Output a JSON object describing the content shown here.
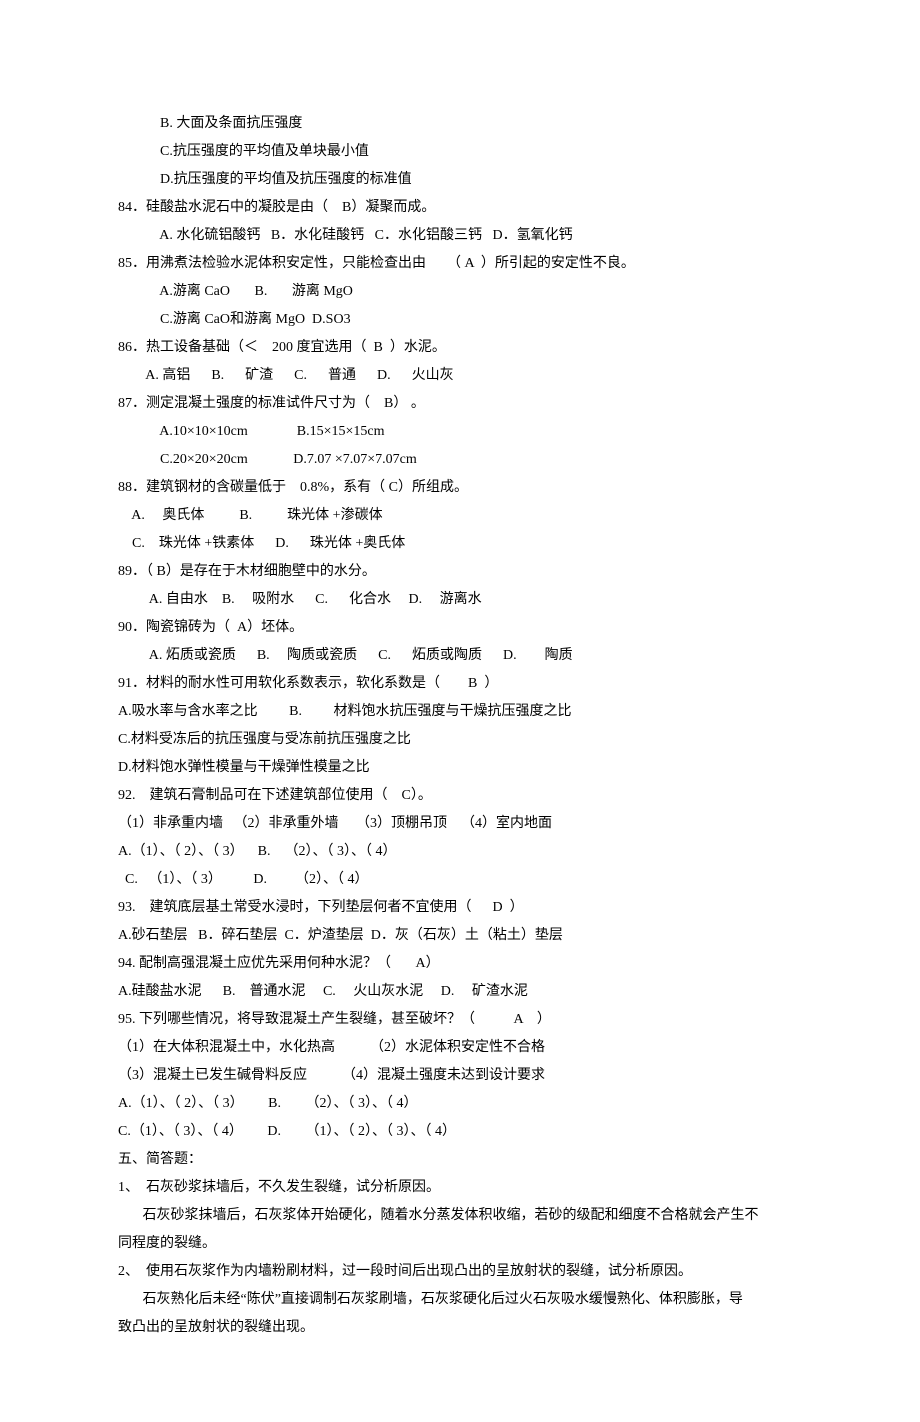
{
  "lines": [
    "            B. 大面及条面抗压强度",
    "            C.抗压强度的平均值及单块最小值",
    "            D.抗压强度的平均值及抗压强度的标准值",
    "84．硅酸盐水泥石中的凝胶是由（    B）凝聚而成。",
    "            A. 水化硫铝酸钙   B．水化硅酸钙   C．水化铝酸三钙   D．氢氧化钙",
    "85．用沸煮法检验水泥体积安定性，只能检查出由      （ A  ）所引起的安定性不良。",
    "            A.游离 CaO       B.       游离 MgO",
    "            C.游离 CaO和游离 MgO  D.SO3",
    "86．热工设备基础（＜    200 度宜选用（  B  ）水泥。",
    "        A. 高铝      B.      矿渣      C.      普通      D.      火山灰",
    "87．测定混凝土强度的标准试件尺寸为（    B） 。",
    "            A.10×10×10cm              B.15×15×15cm",
    "            C.20×20×20cm             D.7.07 ×7.07×7.07cm",
    "88．建筑钢材的含碳量低于    0.8%，系有（ C）所组成。",
    "    A.     奥氏体          B.          珠光体 +渗碳体",
    "    C.    珠光体 +铁素体      D.      珠光体 +奥氏体",
    "89．（ B）是存在于木材细胞壁中的水分。",
    "         A. 自由水    B.     吸附水      C.      化合水     D.     游离水",
    "90．陶瓷锦砖为（  A）坯体。",
    "         A. 炻质或瓷质      B.     陶质或瓷质      C.      炻质或陶质      D.        陶质",
    "91．材料的耐水性可用软化系数表示，软化系数是（        B  ）",
    "A.吸水率与含水率之比         B.         材料饱水抗压强度与干燥抗压强度之比",
    "C.材料受冻后的抗压强度与受冻前抗压强度之比",
    "D.材料饱水弹性模量与干燥弹性模量之比",
    "92.    建筑石膏制品可在下述建筑部位使用（    C）。",
    "（1）非承重内墙   （2）非承重外墙     （3）顶棚吊顶    （4）室内地面",
    "A.（1）、（ 2）、（ 3）    B.    （2）、（ 3）、（ 4）",
    "  C.   （1）、（ 3）         D.        （2）、（ 4）",
    "93.    建筑底层基土常受水浸时，下列垫层何者不宜使用（      D  ）",
    "A.砂石垫层   B．碎石垫层  C．炉渣垫层  D．灰（石灰）土（粘土）垫层",
    "94. 配制高强混凝土应优先采用何种水泥？（       A）",
    "A.硅酸盐水泥      B.    普通水泥     C.     火山灰水泥     D.     矿渣水泥",
    "95. 下列哪些情况，将导致混凝土产生裂缝，甚至破坏？（           A    ）",
    "（1）在大体积混凝土中，水化热高          （2）水泥体积安定性不合格",
    "（3）混凝土已发生碱骨料反应          （4）混凝土强度未达到设计要求",
    "A.（1）、（ 2）、（ 3）       B.       （2）、（ 3）、（ 4）",
    "C.（1）、（ 3）、（ 4）       D.       （1）、（ 2）、（ 3）、（ 4）",
    "五、简答题：",
    "1、  石灰砂浆抹墙后，不久发生裂缝，试分析原因。",
    "       石灰砂浆抹墙后，石灰浆体开始硬化，随着水分蒸发体积收缩，若砂的级配和细度不合格就会产生不",
    "同程度的裂缝。",
    "2、  使用石灰浆作为内墙粉刷材料，过一段时间后出现凸出的呈放射状的裂缝，试分析原因。",
    "       石灰熟化后未经“陈伏”直接调制石灰浆刷墙，石灰浆硬化后过火石灰吸水缓慢熟化、体积膨胀，导",
    "致凸出的呈放射状的裂缝出现。"
  ]
}
